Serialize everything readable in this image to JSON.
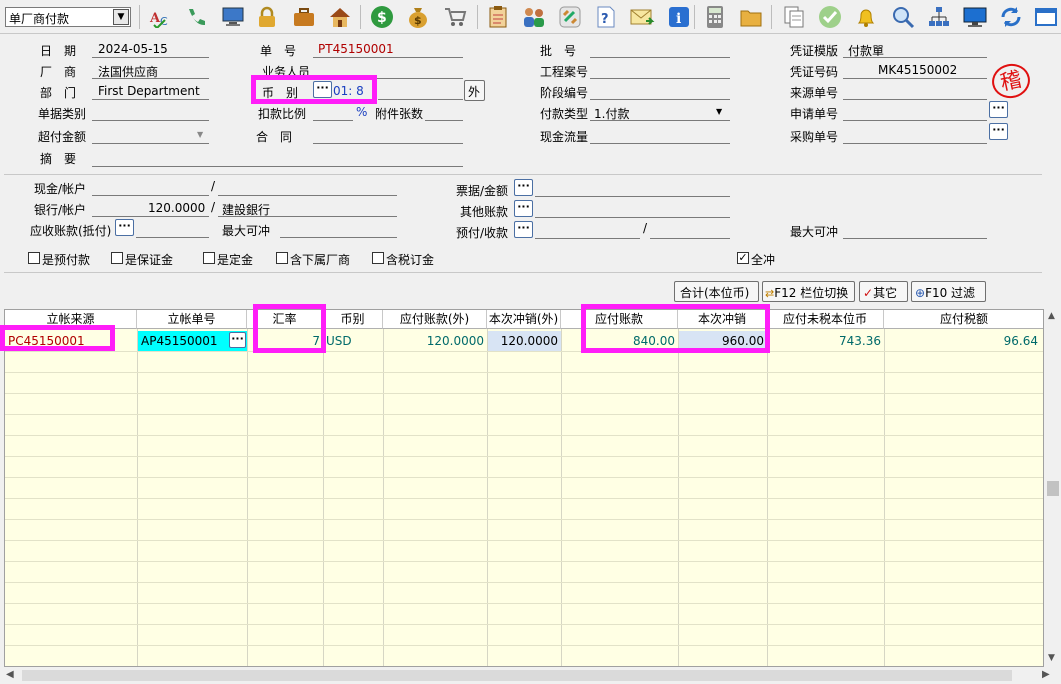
{
  "toolbar": {
    "form_selector": "单厂商付款",
    "icons": [
      "spellcheck-icon",
      "phone-icon",
      "monitor-icon",
      "lock-icon",
      "briefcase-icon",
      "house-icon",
      "dollar-coin-icon",
      "money-bag-icon",
      "shopping-cart-icon",
      "clipboard-icon",
      "users-icon",
      "link-icon",
      "help-document-icon",
      "mail-icon",
      "info-icon",
      "calculator-icon",
      "folder-icon",
      "copy-document-icon",
      "check-circle-icon",
      "bell-icon",
      "magnifier-icon",
      "org-chart-icon",
      "display-icon",
      "refresh-icon",
      "window-icon"
    ]
  },
  "header": {
    "date_label": "日　期",
    "date": "2024-05-15",
    "vendor_label": "厂　商",
    "vendor": "法国供应商",
    "dept_label": "部　门",
    "dept": "First Department",
    "doc_type_label": "单据类别",
    "over_pay_label": "超付金额",
    "summary_label": "摘　要",
    "doc_no_label": "单　号",
    "doc_no": "PT45150001",
    "salesperson_label": "业务人员",
    "currency_label": "币　别",
    "currency_value": "01: 8",
    "foreign_btn": "外",
    "discount_label": "扣款比例",
    "percent": "%",
    "attach_label": "附件张数",
    "contract_label": "合　同",
    "batch_label": "批　号",
    "project_label": "工程案号",
    "stage_label": "阶段编号",
    "pay_type_label": "付款类型",
    "pay_type": "1.付款",
    "cash_flow_label": "现金流量",
    "voucher_tpl_label": "凭证模版",
    "voucher_tpl": "付款單",
    "voucher_no_label": "凭证号码",
    "voucher_no": "MK45150002",
    "source_no_label": "来源单号",
    "apply_no_label": "申请单号",
    "purchase_no_label": "采购单号",
    "stamp": "稽"
  },
  "payment": {
    "cash_label": "现金/帐户",
    "bank_label": "银行/帐户",
    "bank_amount": "120.0000",
    "bank_name": "建設銀行",
    "receivable_label": "应收账款(抵付)",
    "max_offset_label": "最大可冲",
    "notes_label": "票据/金额",
    "other_label": "其他账款",
    "prepay_label": "预付/收款",
    "max_offset_label2": "最大可冲"
  },
  "options": {
    "prepay": "是预付款",
    "deposit": "是保证金",
    "fixed": "是定金",
    "sub_vendor": "含下属厂商",
    "tax_order": "含税订金",
    "full_offset": "全冲"
  },
  "buttons": {
    "total": "合计(本位币)",
    "f12": "F12 栏位切换",
    "other": "其它",
    "f10": "F10 过滤"
  },
  "grid": {
    "columns": [
      "立帐来源",
      "立帐单号",
      "汇率",
      "币别",
      "应付账款(外)",
      "本次冲销(外)",
      "应付账款",
      "本次冲销",
      "应付未税本位币",
      "应付税额"
    ],
    "row": {
      "source": "PC45150001",
      "doc_no": "AP45150001",
      "rate": "7",
      "currency": "USD",
      "payable_foreign": "120.0000",
      "offset_foreign": "120.0000",
      "payable": "840.00",
      "offset": "960.00",
      "untaxed": "743.36",
      "tax": "96.64"
    }
  },
  "colors": {
    "highlight": "#ff1ef8",
    "grid_bg": "#ffffe4",
    "doc_no_red": "#b00000"
  }
}
